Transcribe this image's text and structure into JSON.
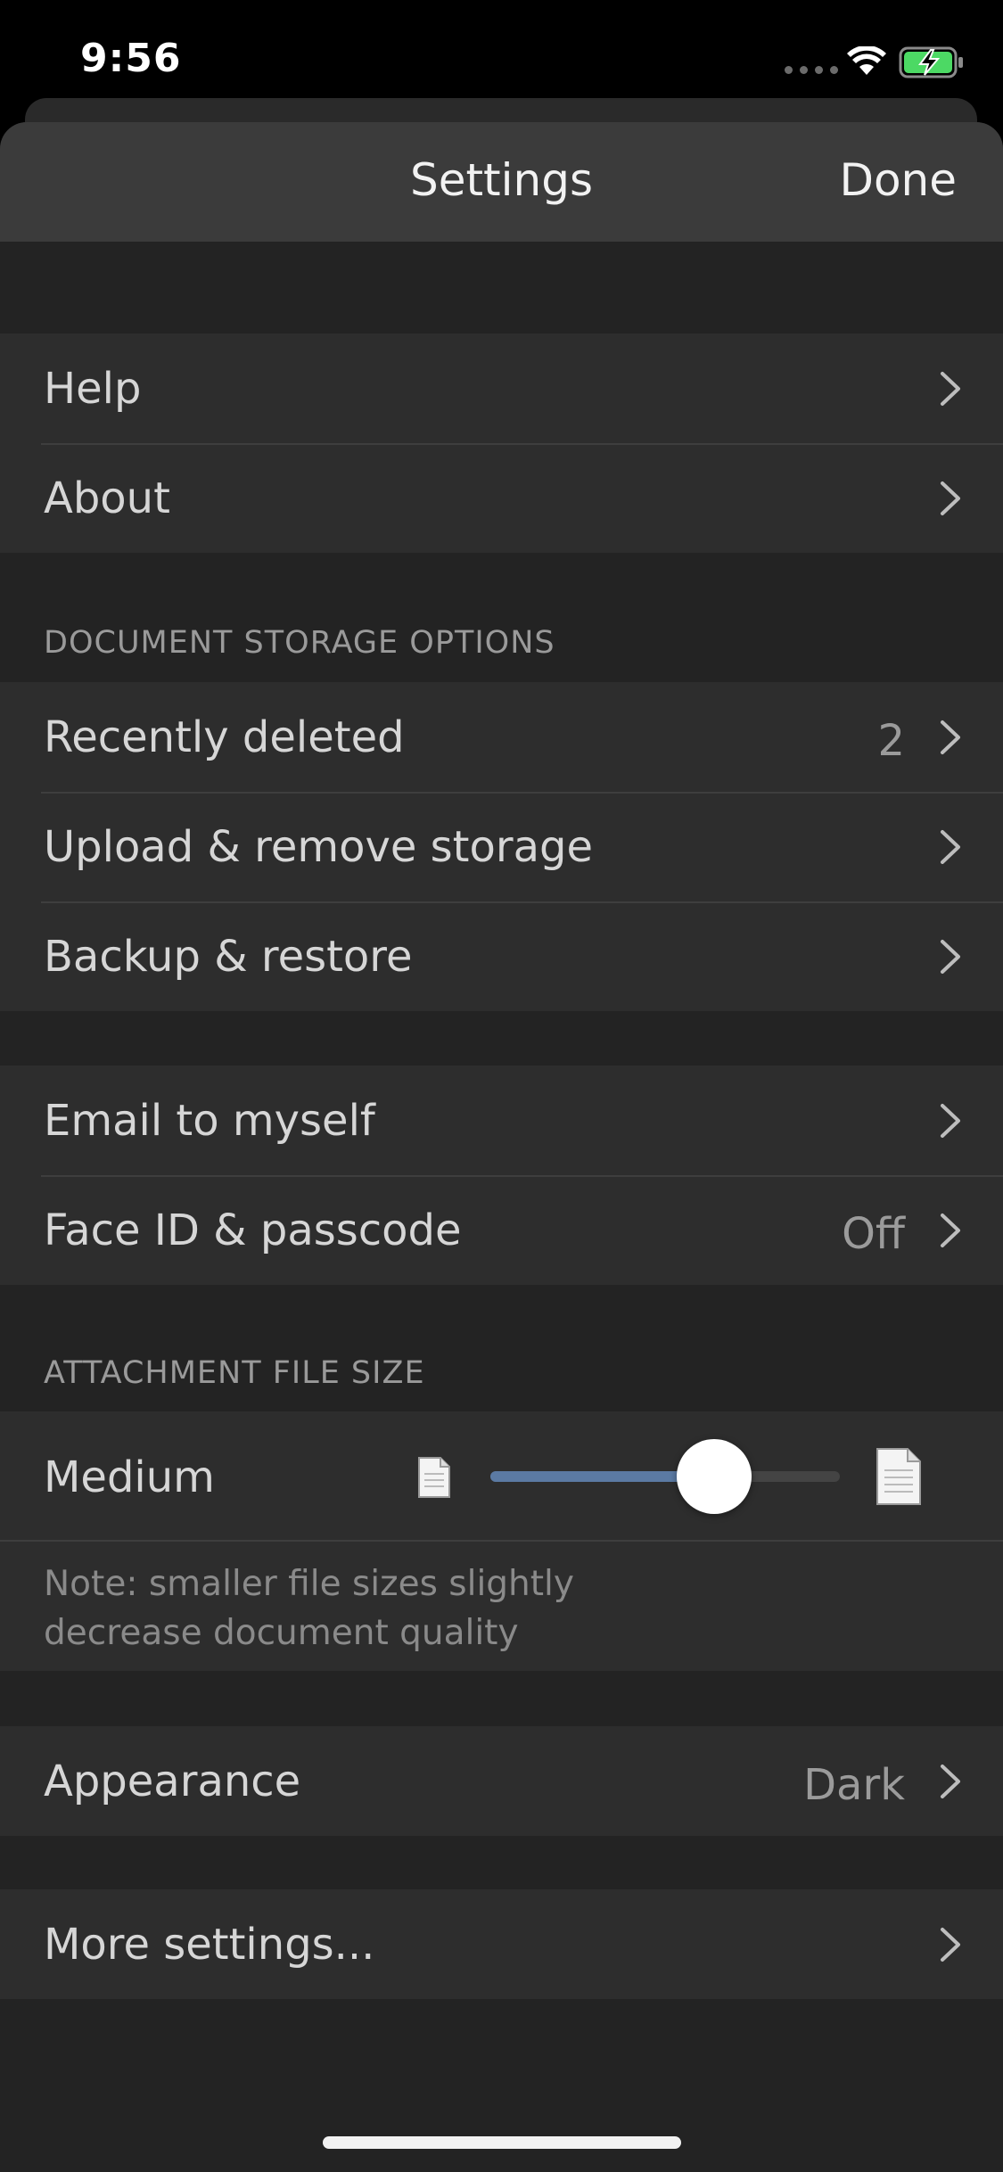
{
  "status": {
    "time": "9:56"
  },
  "nav": {
    "title": "Settings",
    "done_label": "Done"
  },
  "groups": {
    "info": [
      {
        "label": "Help"
      },
      {
        "label": "About"
      }
    ],
    "storage_header": "DOCUMENT STORAGE OPTIONS",
    "storage": [
      {
        "label": "Recently deleted",
        "value": "2"
      },
      {
        "label": "Upload & remove storage"
      },
      {
        "label": "Backup & restore"
      }
    ],
    "security": [
      {
        "label": "Email to myself"
      },
      {
        "label": "Face ID & passcode",
        "value": "Off"
      }
    ],
    "attachment_header": "ATTACHMENT FILE SIZE",
    "attachment": {
      "label": "Medium",
      "slider_value": 0.64,
      "note": "Note: smaller file sizes slightly decrease document quality"
    },
    "appearance": {
      "label": "Appearance",
      "value": "Dark"
    },
    "more": {
      "label": "More settings..."
    }
  },
  "colors": {
    "accent": "#5b7aa3",
    "sheet_bg": "#232323",
    "row_bg": "#2d2d2d",
    "nav_bg": "#3b3b3b"
  }
}
